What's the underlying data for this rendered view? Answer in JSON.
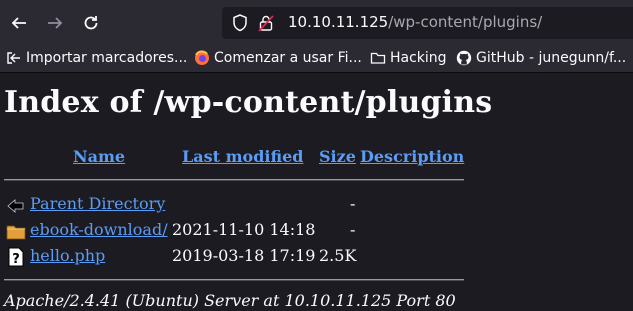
{
  "browser": {
    "url_host": "10.10.11.125",
    "url_path": "/wp-content/plugins/",
    "bookmarks": [
      {
        "label": "Importar marcadores...",
        "icon": "import-icon"
      },
      {
        "label": "Comenzar a usar Fi...",
        "icon": "firefox-icon"
      },
      {
        "label": "Hacking",
        "icon": "folder-icon"
      },
      {
        "label": "GitHub - junegunn/f...",
        "icon": "github-icon"
      }
    ]
  },
  "page": {
    "title": "Index of /wp-content/plugins",
    "columns": {
      "name": "Name",
      "last_modified": "Last modified",
      "size": "Size",
      "description": "Description"
    },
    "rows": [
      {
        "name": "Parent Directory",
        "modified": "",
        "size": "-",
        "icon": "back-arrow-icon"
      },
      {
        "name": "ebook-download/",
        "modified": "2021-11-10 14:18",
        "size": "-",
        "icon": "folder-icon"
      },
      {
        "name": "hello.php",
        "modified": "2019-03-18 17:19",
        "size": "2.5K",
        "icon": "unknown-file-icon"
      }
    ],
    "address": "Apache/2.4.41 (Ubuntu) Server at 10.10.11.125 Port 80"
  }
}
